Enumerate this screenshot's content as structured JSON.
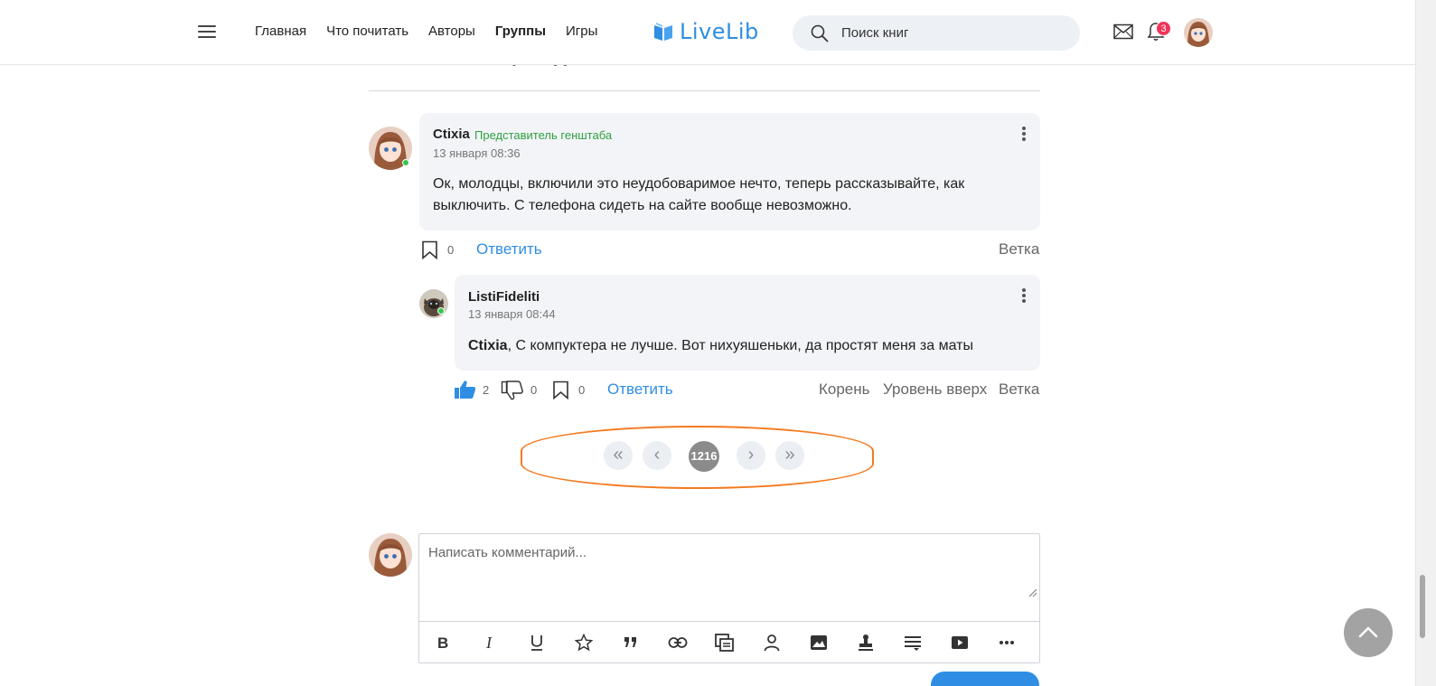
{
  "header": {
    "nav": [
      "Главная",
      "Что почитать",
      "Авторы",
      "Группы",
      "Игры"
    ],
    "active_nav": "Группы",
    "logo": "LiveLib",
    "search_placeholder": "Поиск книг",
    "notifications_count": "3"
  },
  "comments": [
    {
      "author": "Ctixia",
      "role": "Представитель генштаба",
      "date": "13 января 08:36",
      "text": "Ок, молодцы, включили это неудобоваримое нечто, теперь рассказывайте, как выключить. С телефона сидеть на сайте вообще невозможно.",
      "bookmarks": "0",
      "reply_label": "Ответить",
      "thread_label": "Ветка"
    },
    {
      "author": "ListiFideliti",
      "date": "13 января 08:44",
      "mention": "Ctixia",
      "text": ", С компуктера не лучше. Вот нихуяшеньки, да простят меня за маты",
      "likes": "2",
      "dislikes": "0",
      "bookmarks": "0",
      "reply_label": "Ответить",
      "root_label": "Корень",
      "up_label": "Уровень вверх",
      "thread_label": "Ветка"
    }
  ],
  "pagination": {
    "first": "«",
    "prev": "‹",
    "current": "1216",
    "next": "›",
    "last": "»"
  },
  "comment_form": {
    "placeholder": "Написать комментарий..."
  },
  "colors": {
    "accent": "#2f8ee3",
    "badge": "#f0345a",
    "role": "#2ea043",
    "highlight": "#f47a20",
    "online": "#36c64b"
  }
}
